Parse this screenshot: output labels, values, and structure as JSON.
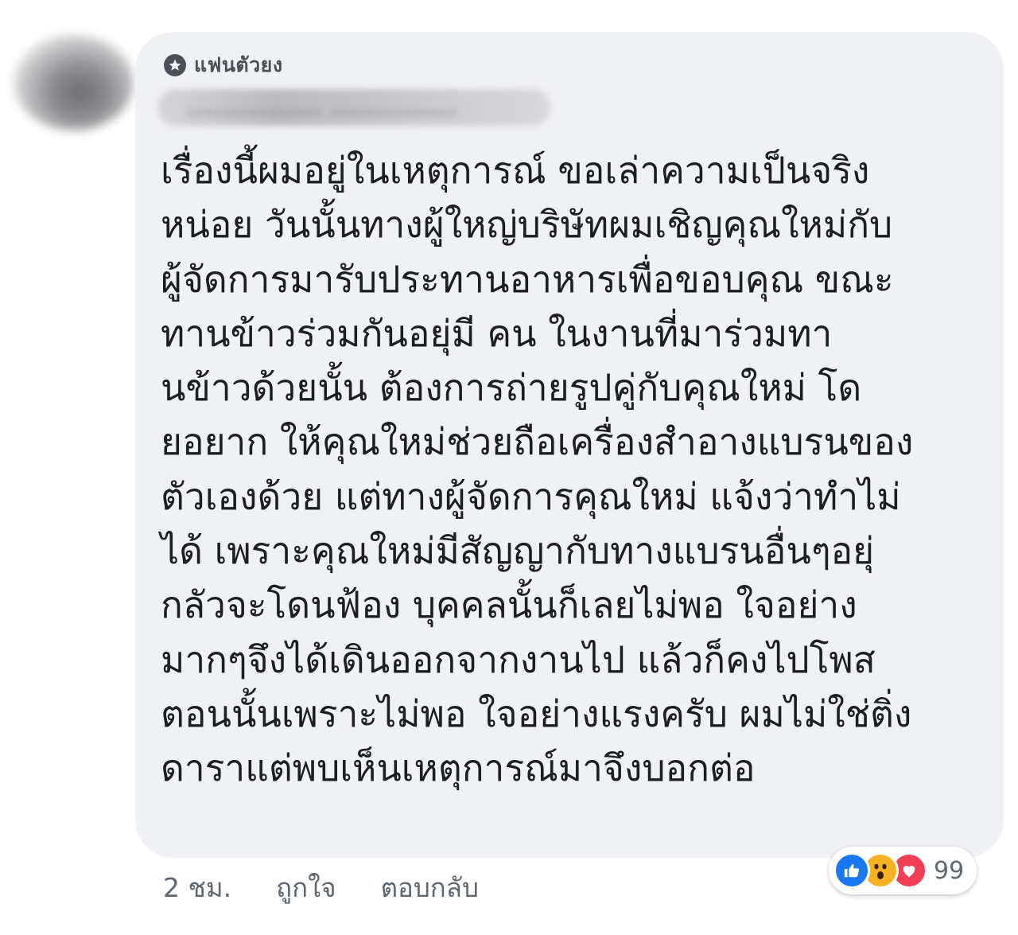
{
  "comment": {
    "badge_label": "แฟนตัวยง",
    "badge_icon": "star-badge-icon",
    "author_name": "............... ..............",
    "lines": [
      "เรื่องนี้ผมอยู่ในเหตุการณ์ ขอเล่าความเป็นจริง",
      "หน่อย  วันนั้นทางผู้ใหญ่บริษัทผมเชิญคุณใหม่กับ",
      "ผู้จัดการมารับประทานอาหารเพื่อขอบคุณ  ขณะ",
      "ทานข้าวร่วมกันอยุ่มี คน ในงานที่มาร่วมทา",
      "นข้าวด้วยนั้น  ต้องการถ่ายรูปคู่กับคุณใหม่ โด",
      "ยอยาก ให้คุณใหม่ช่วยถือเครื่องสำอางแบรนของ",
      "ตัวเองด้วย แต่ทางผู้จัดการคุณใหม่ แจ้งว่าทำไม่",
      "ได้ เพราะคุณใหม่มีสัญญากับทางแบรนอื่นๆอยุ่",
      "กลัวจะโดนฟ้อง   บุคคลนั้นก็เลยไม่พอ ใจอย่าง",
      "มากๆจึงได้เดินออกจากงานไป แล้วก็คงไปโพส",
      "ตอนนั้นเพราะไม่พอ ใจอย่างแรงครับ   ผมไม่ใช่ติ่ง",
      "ดาราแต่พบเห็นเหตุการณ์มาจึงบอกต่อ"
    ]
  },
  "actions": {
    "time": "2 ชม.",
    "like_label": "ถูกใจ",
    "reply_label": "ตอบกลับ"
  },
  "reactions": {
    "icons": [
      "like-icon",
      "wow-icon",
      "love-icon"
    ],
    "count": "99",
    "colors": {
      "like": "#1877f2",
      "wow": "#f7b125",
      "love": "#f33e58"
    }
  }
}
